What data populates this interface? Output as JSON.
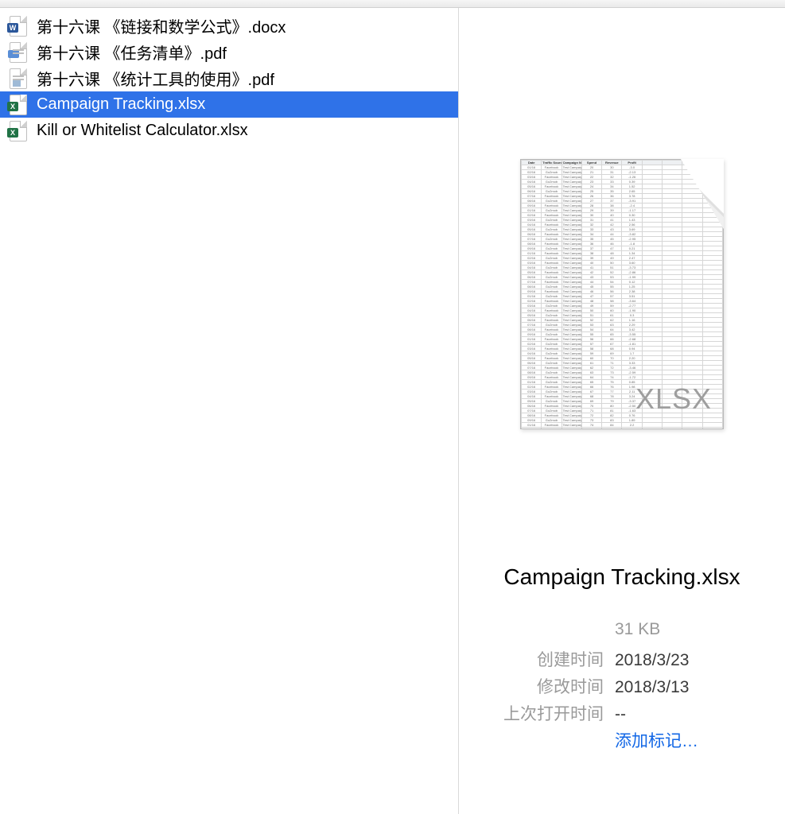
{
  "files": [
    {
      "name": "第十六课 《链接和数学公式》.docx",
      "type": "docx",
      "selected": false
    },
    {
      "name": "第十六课 《任务清单》.pdf",
      "type": "pdf-preview",
      "selected": false
    },
    {
      "name": "第十六课 《统计工具的使用》.pdf",
      "type": "pdf",
      "selected": false
    },
    {
      "name": "Campaign Tracking.xlsx",
      "type": "xlsx",
      "selected": true
    },
    {
      "name": "Kill or Whitelist Calculator.xlsx",
      "type": "xlsx",
      "selected": false
    }
  ],
  "preview": {
    "filename": "Campaign Tracking.xlsx",
    "badge": "XLSX",
    "size": "31 KB",
    "labels": {
      "created": "创建时间",
      "modified": "修改时间",
      "lastOpened": "上次打开时间"
    },
    "created": "2018/3/23",
    "modified": "2018/3/13",
    "lastOpened": "--",
    "addTags": "添加标记…",
    "thumbHeaders": [
      "Date",
      "Traffic Source",
      "Campaign Name",
      "Spend",
      "Revenue",
      "Profit"
    ],
    "thumbSampleRows": 56
  }
}
